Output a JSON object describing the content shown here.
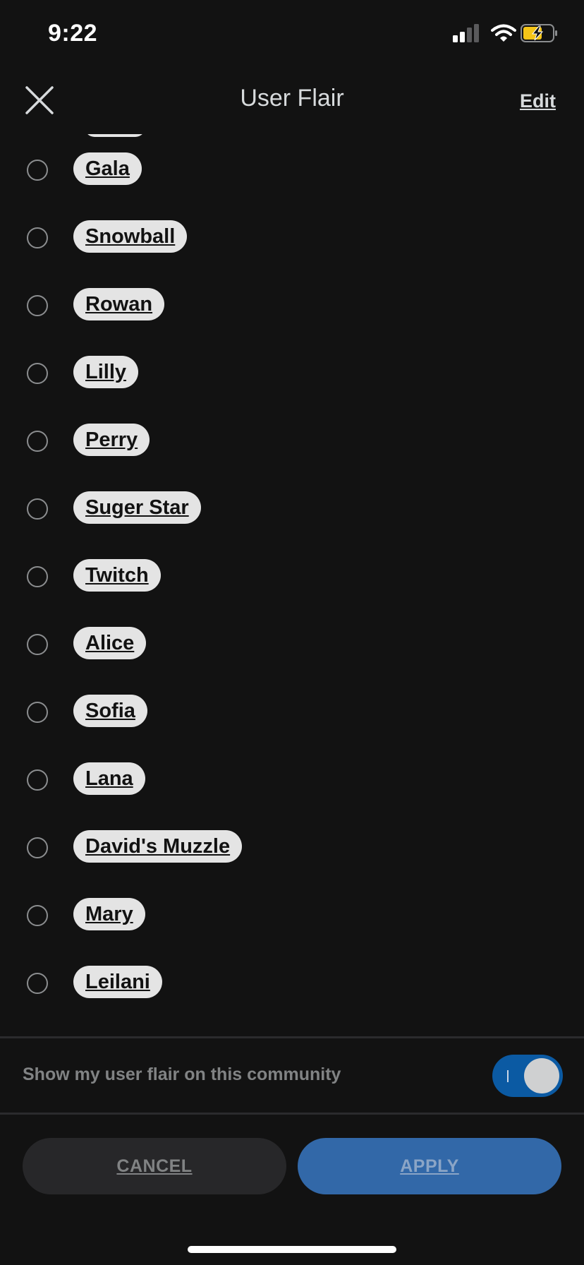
{
  "status_bar": {
    "time": "9:22",
    "icons": [
      "signal-icon",
      "wifi-icon",
      "battery-charging-icon"
    ],
    "battery_color": "#f5c518"
  },
  "header": {
    "title": "User Flair",
    "edit_label": "Edit",
    "close_icon": "close-icon"
  },
  "flairs": [
    {
      "label": "Gala",
      "selected": false
    },
    {
      "label": "Snowball",
      "selected": false
    },
    {
      "label": "Rowan",
      "selected": false
    },
    {
      "label": "Lilly",
      "selected": false
    },
    {
      "label": "Perry",
      "selected": false
    },
    {
      "label": "Suger Star",
      "selected": false
    },
    {
      "label": "Twitch",
      "selected": false
    },
    {
      "label": "Alice",
      "selected": false
    },
    {
      "label": "Sofia",
      "selected": false
    },
    {
      "label": "Lana",
      "selected": false
    },
    {
      "label": "David's Muzzle",
      "selected": false
    },
    {
      "label": "Mary",
      "selected": false
    },
    {
      "label": "Leilani",
      "selected": false
    }
  ],
  "toggle": {
    "label": "Show my user flair on this community",
    "on": true,
    "accent": "#0b5aa3"
  },
  "buttons": {
    "cancel_label": "CANCEL",
    "apply_label": "APPLY",
    "apply_color": "#3268a8"
  }
}
